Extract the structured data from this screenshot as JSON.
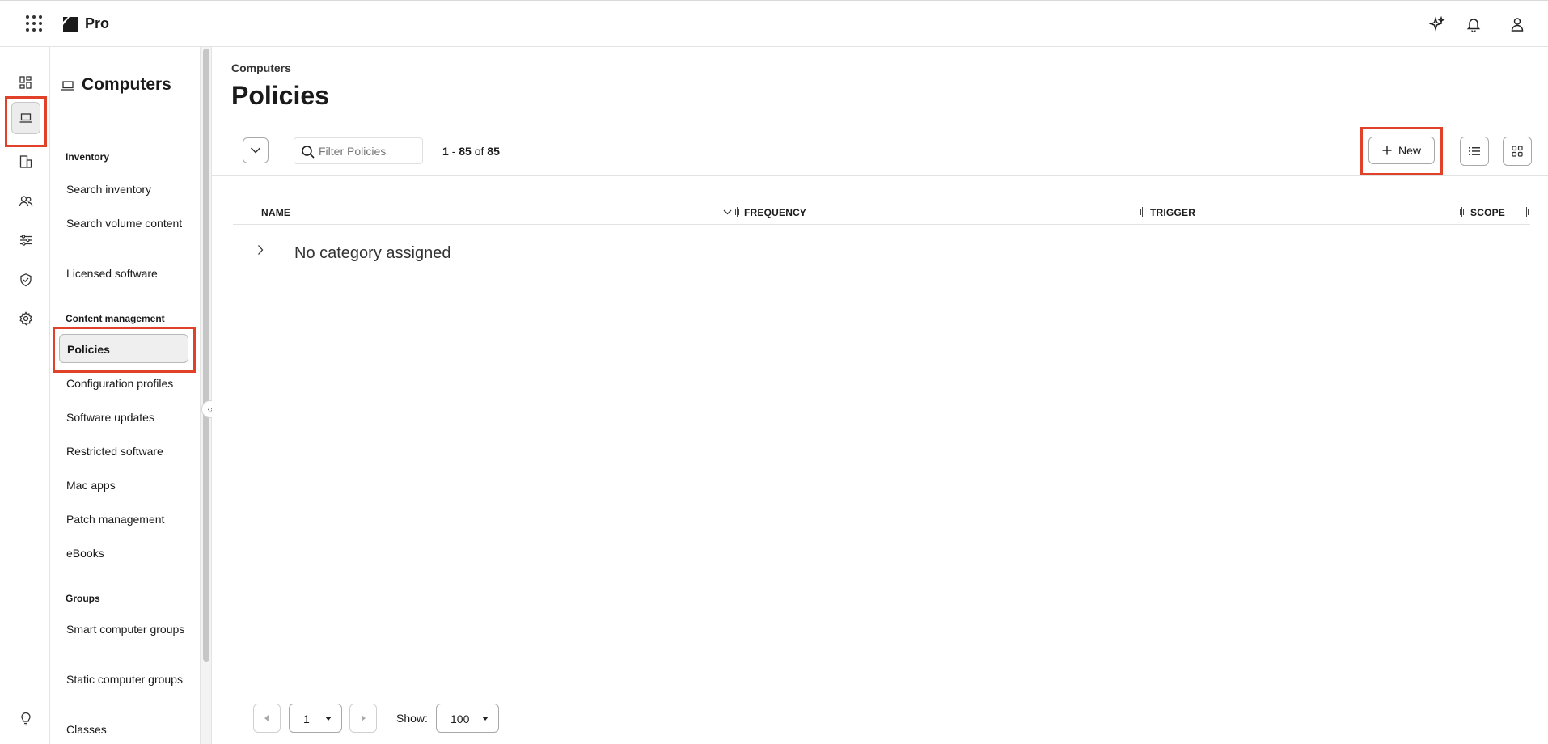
{
  "app": {
    "brand_name": "Pro"
  },
  "topbar": {
    "icons": [
      "apps-grid-icon",
      "sparkle-icon",
      "bell-icon",
      "user-icon"
    ]
  },
  "rail": {
    "items": [
      {
        "name": "dashboard-icon"
      },
      {
        "name": "laptop-icon",
        "active": true
      },
      {
        "name": "devices-icon"
      },
      {
        "name": "users-icon"
      },
      {
        "name": "sliders-icon"
      },
      {
        "name": "shield-check-icon"
      },
      {
        "name": "gear-icon"
      },
      {
        "name": "lightbulb-icon"
      }
    ]
  },
  "section": {
    "title": "Computers",
    "groups": [
      {
        "title": "Inventory",
        "items": [
          "Search inventory",
          "Search volume content",
          "Licensed software"
        ]
      },
      {
        "title": "Content management",
        "items": [
          "Policies",
          "Configuration profiles",
          "Software updates",
          "Restricted software",
          "Mac apps",
          "Patch management",
          "eBooks"
        ]
      },
      {
        "title": "Groups",
        "items": [
          "Smart computer groups",
          "Static computer groups",
          "Classes"
        ]
      }
    ],
    "active_item": "Policies"
  },
  "main": {
    "breadcrumb": "Computers",
    "title": "Policies",
    "search": {
      "placeholder": "Filter Policies",
      "value": ""
    },
    "count": {
      "start": "1",
      "end": "85",
      "of_label": "of",
      "total": "85",
      "dash": "-"
    },
    "new_button_label": "New",
    "columns": [
      "NAME",
      "FREQUENCY",
      "TRIGGER",
      "SCOPE"
    ],
    "groups": [
      {
        "label": "No category assigned",
        "expanded": false
      }
    ],
    "pagination": {
      "page": "1",
      "show_label": "Show:",
      "page_size": "100"
    }
  },
  "colors": {
    "highlight": "#e04128",
    "active_bg": "#efefef"
  }
}
